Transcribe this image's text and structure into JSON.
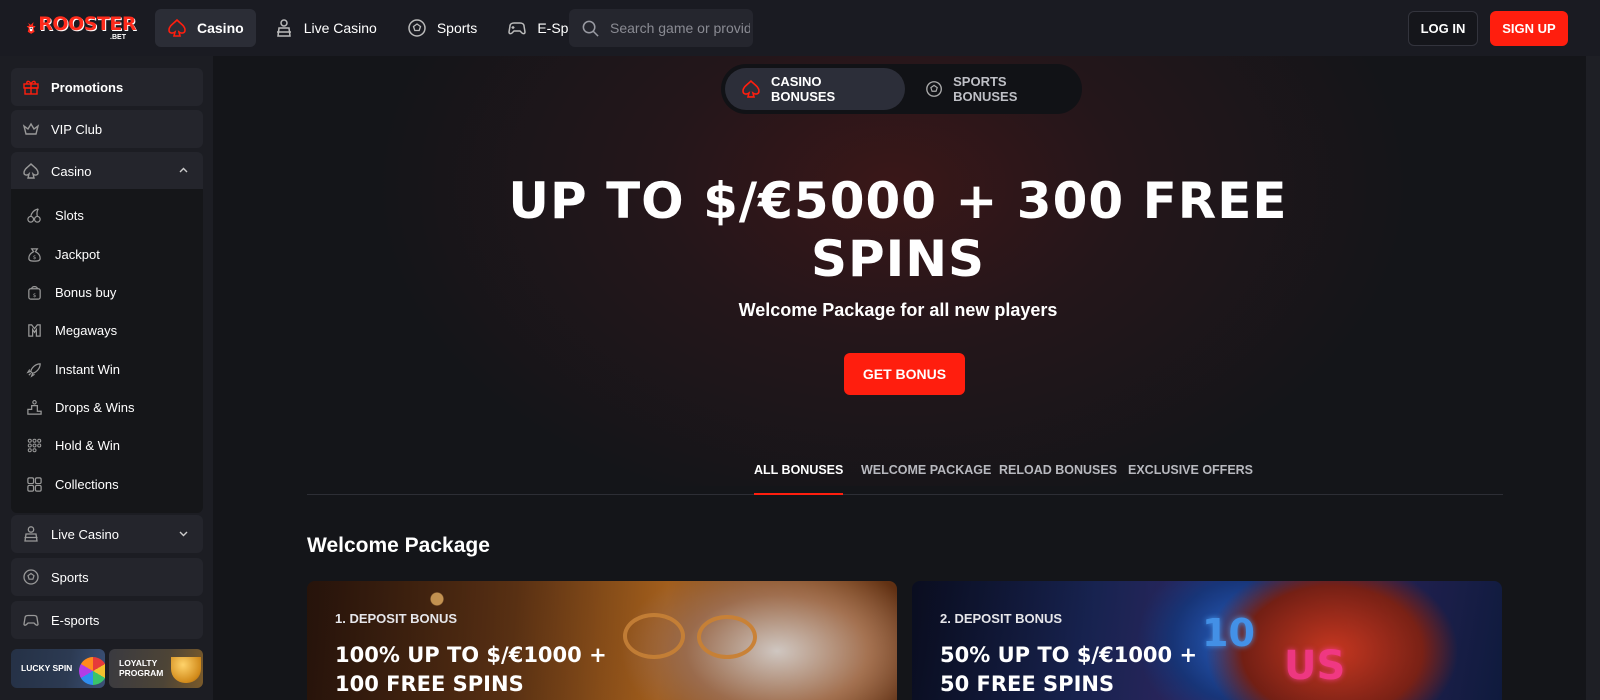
{
  "brand": {
    "name": "ROOSTER",
    "suffix": ".BET"
  },
  "nav": {
    "items": [
      {
        "label": "Casino",
        "icon": "spade-icon",
        "active": true
      },
      {
        "label": "Live Casino",
        "icon": "dealer-icon",
        "active": false
      },
      {
        "label": "Sports",
        "icon": "soccer-ball-icon",
        "active": false
      },
      {
        "label": "E-Sports",
        "icon": "gamepad-icon",
        "active": false
      }
    ]
  },
  "search": {
    "placeholder": "Search game or provider"
  },
  "auth": {
    "login": "LOG IN",
    "signup": "SIGN UP"
  },
  "sidebar": {
    "top": [
      {
        "label": "Promotions",
        "icon": "gift-icon"
      },
      {
        "label": "VIP Club",
        "icon": "crown-icon"
      },
      {
        "label": "Casino",
        "icon": "spade-icon",
        "expanded": true
      }
    ],
    "casino_sub": [
      {
        "label": "Slots",
        "icon": "cherries-icon"
      },
      {
        "label": "Jackpot",
        "icon": "money-bag-icon"
      },
      {
        "label": "Bonus buy",
        "icon": "bonus-bag-icon"
      },
      {
        "label": "Megaways",
        "icon": "megaways-icon"
      },
      {
        "label": "Instant Win",
        "icon": "rocket-icon"
      },
      {
        "label": "Drops & Wins",
        "icon": "podium-icon"
      },
      {
        "label": "Hold & Win",
        "icon": "dots-grid-icon"
      },
      {
        "label": "Collections",
        "icon": "collections-icon"
      }
    ],
    "bottom": [
      {
        "label": "Live Casino",
        "icon": "dealer-icon",
        "expandable": true
      },
      {
        "label": "Sports",
        "icon": "soccer-ball-icon"
      },
      {
        "label": "E-sports",
        "icon": "gamepad-icon"
      }
    ],
    "tiles": [
      {
        "label": "LUCKY SPIN"
      },
      {
        "label_line1": "LOYALTY",
        "label_line2": "PROGRAM"
      }
    ]
  },
  "hero": {
    "toggle": {
      "casino": "CASINO BONUSES",
      "sports": "SPORTS BONUSES"
    },
    "title": "UP TO $/€5000 + 300 FREE SPINS",
    "subtitle": "Welcome Package for all new players",
    "cta": "GET BONUS"
  },
  "tabs": [
    {
      "label": "ALL BONUSES",
      "active": true
    },
    {
      "label": "WELCOME PACKAGE",
      "active": false
    },
    {
      "label": "RELOAD BONUSES",
      "active": false
    },
    {
      "label": "EXCLUSIVE OFFERS",
      "active": false
    }
  ],
  "section": {
    "title": "Welcome Package"
  },
  "cards": [
    {
      "label": "1. DEPOSIT BONUS",
      "title_line1": "100% UP TO $/€1000 +",
      "title_line2": "100 FREE SPINS"
    },
    {
      "label": "2. DEPOSIT BONUS",
      "title_line1": "50% UP TO $/€1000 +",
      "title_line2": "50 FREE SPINS"
    }
  ],
  "colors": {
    "accent": "#ff1e0e",
    "background": "#141519",
    "panel": "#24252c"
  }
}
